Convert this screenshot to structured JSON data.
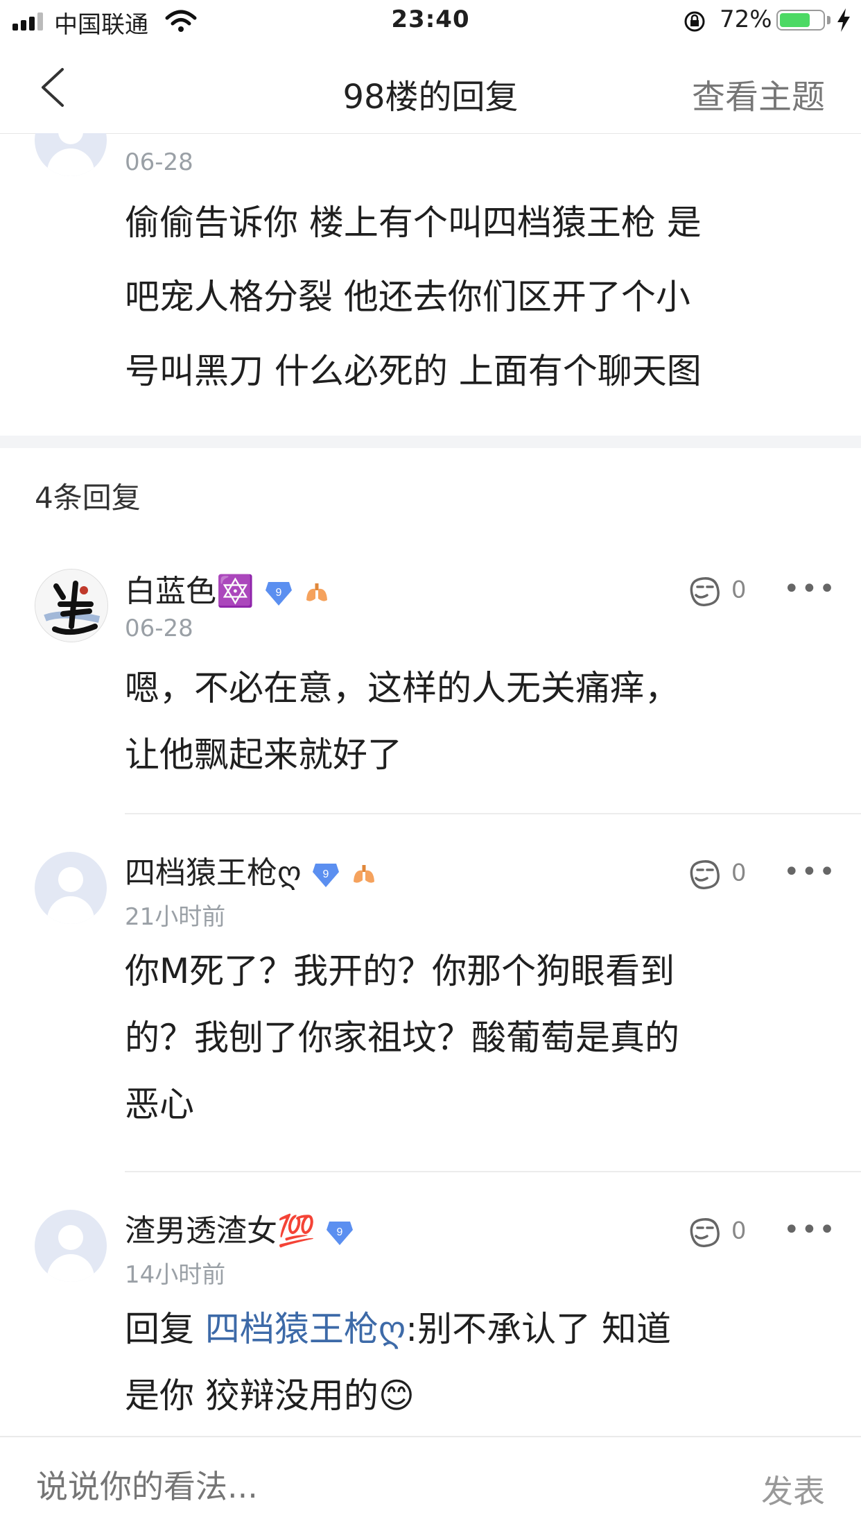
{
  "status_bar": {
    "carrier": "中国联通",
    "time": "23:40",
    "battery_percent": "72%",
    "battery_level": 0.72
  },
  "nav": {
    "title": "98楼的回复",
    "right_action": "查看主题"
  },
  "main_post": {
    "date": "06-28",
    "text_lines": [
      "偷偷告诉你 楼上有个叫四档猿王枪 是",
      "吧宠人格分裂 他还去你们区开了个小",
      "号叫黑刀 什么必死的 上面有个聊天图"
    ]
  },
  "reply_count_label": "4条回复",
  "replies": [
    {
      "username": "白蓝色🔯",
      "level": "9",
      "date": "06-28",
      "likes": "0",
      "text_lines": [
        "嗯，不必在意，这样的人无关痛痒，",
        "让他飘起来就好了"
      ]
    },
    {
      "username": "四档猿王枪ღ",
      "level": "9",
      "date": "21小时前",
      "likes": "0",
      "text_lines": [
        "你M死了？我开的？你那个狗眼看到",
        "的？我刨了你家祖坟？酸葡萄是真的",
        "恶心"
      ]
    },
    {
      "username": "渣男透渣女💯",
      "level": "9",
      "date": "14小时前",
      "likes": "0",
      "reply_prefix": "回复 ",
      "reply_to": "四档猿王枪ღ",
      "text_line1_rest": ":别不承认了 知道",
      "text_line2": "是你 狡辩没用的😊"
    }
  ],
  "composer": {
    "placeholder": "说说你的看法...",
    "send_label": "发表"
  },
  "colors": {
    "link": "#3d6aa8",
    "level_badge": "#5b8ff0",
    "battery": "#4cd964"
  }
}
